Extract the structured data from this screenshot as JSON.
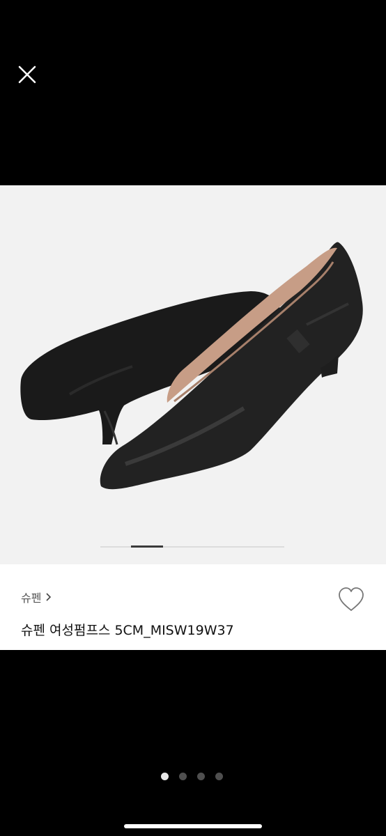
{
  "product": {
    "brand": "슈펜",
    "title": "슈펜 여성펌프스 5CM_MISW19W37"
  },
  "image_carousel": {
    "image": "black-leather-pointed-pumps",
    "total_images": 4,
    "current_index": 1
  },
  "icons": {
    "close": "close-icon",
    "brand_chevron": "chevron-right-icon",
    "favorite": "heart-outline-icon"
  },
  "colors": {
    "background": "#000000",
    "image_background": "#f2f2f2",
    "panel_background": "#ffffff",
    "active_dot": "#e8e8e8",
    "inactive_dot": "#4f4f4f"
  }
}
